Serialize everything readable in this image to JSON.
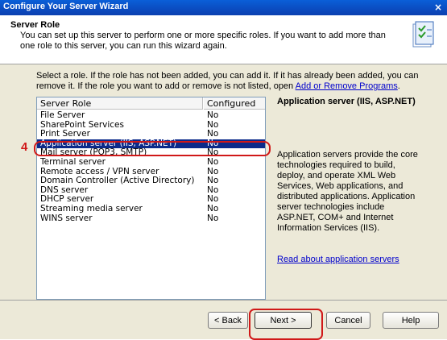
{
  "window": {
    "title": "Configure Your Server Wizard",
    "close_glyph": "×"
  },
  "header": {
    "title": "Server Role",
    "description": "You can set up this server to perform one or more specific roles. If you want to add more than one role to this server, you can run this wizard again.",
    "icon": "wizard-checklist-icon"
  },
  "instructions": {
    "text": "Select a role. If the role has not been added, you can add it. If it has already been added, you can remove it. If the role you want to add or remove is not listed, open ",
    "link": "Add or Remove Programs",
    "suffix": "."
  },
  "table": {
    "headers": [
      "Server Role",
      "Configured"
    ],
    "rows": [
      {
        "role": "File Server",
        "configured": "No"
      },
      {
        "role": "SharePoint Services",
        "configured": "No"
      },
      {
        "role": "Print Server",
        "configured": "No"
      },
      {
        "role": "Application server (IIS, ASP.NET)",
        "configured": "No",
        "selected": true
      },
      {
        "role": "Mail server (POP3, SMTP)",
        "configured": "No"
      },
      {
        "role": "Terminal server",
        "configured": "No"
      },
      {
        "role": "Remote access / VPN server",
        "configured": "No"
      },
      {
        "role": "Domain Controller (Active Directory)",
        "configured": "No"
      },
      {
        "role": "DNS server",
        "configured": "No"
      },
      {
        "role": "DHCP server",
        "configured": "No"
      },
      {
        "role": "Streaming media server",
        "configured": "No"
      },
      {
        "role": "WINS server",
        "configured": "No"
      }
    ]
  },
  "detail": {
    "title": "Application server (IIS, ASP.NET)",
    "description": "Application servers provide the core technologies required to build, deploy, and operate XML Web Services, Web applications, and distributed applications. Application server technologies include ASP.NET, COM+ and Internet Information Services (IIS).",
    "link": "Read about application servers"
  },
  "annotation": {
    "step_number": "4",
    "color": "#d01818"
  },
  "buttons": {
    "back": "< Back",
    "next": "Next >",
    "cancel": "Cancel",
    "help": "Help"
  }
}
